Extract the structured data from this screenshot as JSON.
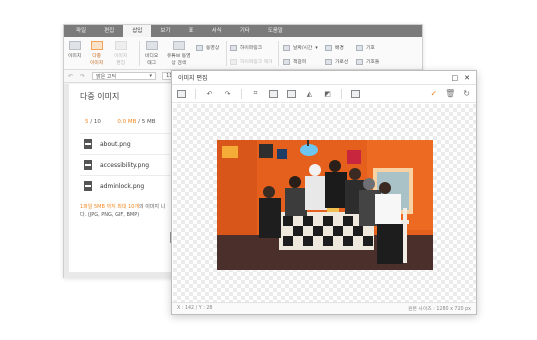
{
  "menubar": {
    "tabs": [
      "파일",
      "편집",
      "삽입",
      "보기",
      "표",
      "서식",
      "기타",
      "도움말"
    ],
    "active_index": 2
  },
  "ribbon": {
    "image": "이미지",
    "multi_image_line1": "다중",
    "multi_image_line2": "이미지",
    "image_edit_line1": "이미지",
    "image_edit_line2": "편집",
    "video_line1": "비디오",
    "video_line2": "태그",
    "youtube_line1": "유튜브 동영",
    "youtube_line2": "상 검색",
    "movie": "동영상",
    "hyperlink": "하이퍼링크",
    "remove_hyperlink": "하이퍼링크 제거",
    "datetime": "날짜/시간",
    "bookmark": "책갈피",
    "background": "배경",
    "horizontal_line": "가로선",
    "symbol": "기호",
    "emoticon": "이모티콘",
    "more": "기호들"
  },
  "fmtbar": {
    "font": "맑은 고딕",
    "size": "11pt"
  },
  "multi_image_panel": {
    "title": "다중 이미지",
    "count_current": "5",
    "count_total": "/ 10",
    "size_current": "0.0 MB",
    "size_total": "/ 5 MB",
    "files": [
      "about.png",
      "accessibility.png",
      "adminlock.png"
    ],
    "note_highlight": "1파일 5MB 까지 최대 10개",
    "note_rest": "의 이미지 니다. (JPG, PNG, GIF, BMP)"
  },
  "image_edit_dialog": {
    "title": "이미지 편집",
    "status_left": "X : 142 / Y : 28",
    "status_right": "원본 사이즈 : 1280 x 720 px",
    "tool_icons": [
      "image-icon",
      "undo-icon",
      "redo-icon",
      "crop-icon",
      "resize-icon",
      "rotate-icon",
      "flip-icon",
      "filter-icon",
      "pen-icon"
    ],
    "confirm_icon": "check-icon",
    "delete_icon": "trash-icon",
    "reset_icon": "refresh-icon"
  },
  "colors": {
    "accent": "#f2871f",
    "menubar": "#7b7b7b",
    "photo_wall": "#e7631f"
  }
}
